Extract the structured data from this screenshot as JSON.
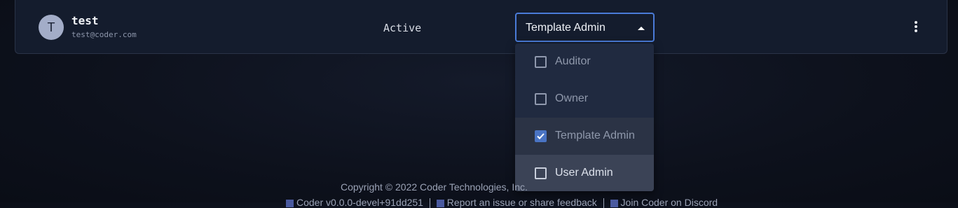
{
  "user": {
    "avatar_initial": "T",
    "name": "test",
    "email": "test@coder.com",
    "status": "Active"
  },
  "role_select": {
    "value": "Template Admin",
    "options": [
      {
        "label": "Auditor",
        "checked": false
      },
      {
        "label": "Owner",
        "checked": false
      },
      {
        "label": "Template Admin",
        "checked": true
      },
      {
        "label": "User Admin",
        "checked": false
      }
    ]
  },
  "footer": {
    "copyright": "Copyright © 2022 Coder Technologies, Inc.",
    "version": "Coder v0.0.0-devel+91dd251",
    "report_link": "Report an issue or share feedback",
    "discord_link": "Join Coder on Discord"
  },
  "colors": {
    "accent": "#4a7bd8",
    "checkbox_checked": "#4a74c4"
  },
  "icons": [
    "more-vert-icon",
    "arrow-drop-up-icon",
    "checkbox-icon",
    "github-icon",
    "discord-icon"
  ]
}
